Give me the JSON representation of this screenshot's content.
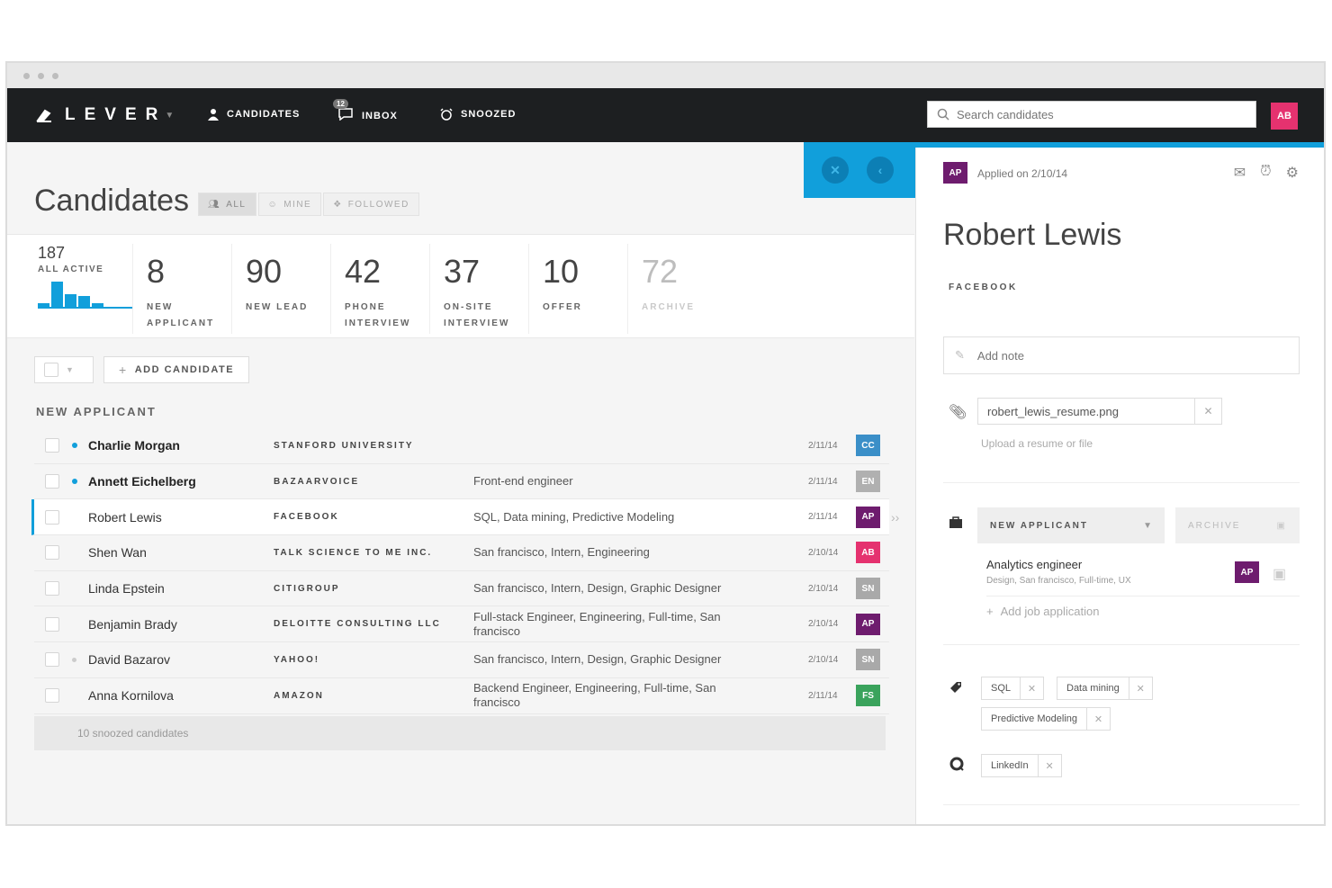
{
  "nav": {
    "logo": "LEVER",
    "items": [
      {
        "label": "CANDIDATES",
        "icon": "person-icon"
      },
      {
        "label": "INBOX",
        "icon": "chat-icon",
        "badge": "12"
      },
      {
        "label": "SNOOZED",
        "icon": "alarm-icon"
      }
    ],
    "search_placeholder": "Search candidates",
    "user_initials": "AB"
  },
  "page": {
    "title": "Candidates",
    "filters": [
      "ALL",
      "MINE",
      "FOLLOWED"
    ],
    "active_filter": "ALL"
  },
  "stats": {
    "all_active": {
      "value": "187",
      "label": "ALL ACTIVE"
    },
    "stages": [
      {
        "value": "8",
        "label_l1": "NEW",
        "label_l2": "APPLICANT"
      },
      {
        "value": "90",
        "label_l1": "NEW LEAD",
        "label_l2": ""
      },
      {
        "value": "42",
        "label_l1": "PHONE",
        "label_l2": "INTERVIEW"
      },
      {
        "value": "37",
        "label_l1": "ON-SITE",
        "label_l2": "INTERVIEW"
      },
      {
        "value": "10",
        "label_l1": "OFFER",
        "label_l2": ""
      },
      {
        "value": "72",
        "label_l1": "ARCHIVE",
        "label_l2": ""
      }
    ]
  },
  "toolbar": {
    "add_candidate": "ADD CANDIDATE"
  },
  "list": {
    "section": "NEW APPLICANT",
    "rows": [
      {
        "name": "Charlie Morgan",
        "org": "STANFORD UNIVERSITY",
        "tags": "",
        "date": "2/11/14",
        "avatar": "CC",
        "color": "#3b8fc8",
        "new": true
      },
      {
        "name": "Annett Eichelberg",
        "org": "BAZAARVOICE",
        "tags": "Front-end engineer",
        "date": "2/11/14",
        "avatar": "EN",
        "color": "#b0b0b0",
        "new": true
      },
      {
        "name": "Robert Lewis",
        "org": "FACEBOOK",
        "tags": "SQL, Data mining, Predictive Modeling",
        "date": "2/11/14",
        "avatar": "AP",
        "color": "#6e1c6e",
        "new": false,
        "selected": true
      },
      {
        "name": "Shen Wan",
        "org": "TALK SCIENCE TO ME INC.",
        "tags": "San francisco, Intern, Engineering",
        "date": "2/10/14",
        "avatar": "AB",
        "color": "#e5326f",
        "new": false
      },
      {
        "name": "Linda Epstein",
        "org": "CITIGROUP",
        "tags": "San francisco, Intern, Design, Graphic Designer",
        "date": "2/10/14",
        "avatar": "SN",
        "color": "#a9a9a9",
        "new": false
      },
      {
        "name": "Benjamin Brady",
        "org": "DELOITTE CONSULTING LLC",
        "tags": "Full-stack Engineer, Engineering, Full-time, San francisco",
        "date": "2/10/14",
        "avatar": "AP",
        "color": "#6e1c6e",
        "new": false
      },
      {
        "name": "David Bazarov",
        "org": "YAHOO!",
        "tags": "San francisco, Intern, Design, Graphic Designer",
        "date": "2/10/14",
        "avatar": "SN",
        "color": "#a9a9a9",
        "new": false,
        "snoozed": true
      },
      {
        "name": "Anna Kornilova",
        "org": "AMAZON",
        "tags": "Backend Engineer, Engineering, Full-time, San francisco",
        "date": "2/11/14",
        "avatar": "FS",
        "color": "#3aa35c",
        "new": false
      }
    ],
    "snoozed_text": "10 snoozed candidates"
  },
  "profile": {
    "avatar": "AP",
    "applied": "Applied on  2/10/14",
    "name": "Robert Lewis",
    "org": "FACEBOOK",
    "note_placeholder": "Add note",
    "resume_file": "robert_lewis_resume.png",
    "upload_text": "Upload a resume or file",
    "stage": "NEW APPLICANT",
    "archive": "ARCHIVE",
    "job_title": "Analytics engineer",
    "job_sub": "Design, San francisco, Full-time, UX",
    "job_avatar": "AP",
    "add_job": "Add job application",
    "tags": [
      "SQL",
      "Data mining",
      "Predictive Modeling"
    ],
    "links": [
      "LinkedIn"
    ]
  },
  "colors": {
    "accent": "#119fdb",
    "nav_bg": "#1d1f21",
    "brand_pink": "#e5326f",
    "purple": "#6e1c6e"
  }
}
